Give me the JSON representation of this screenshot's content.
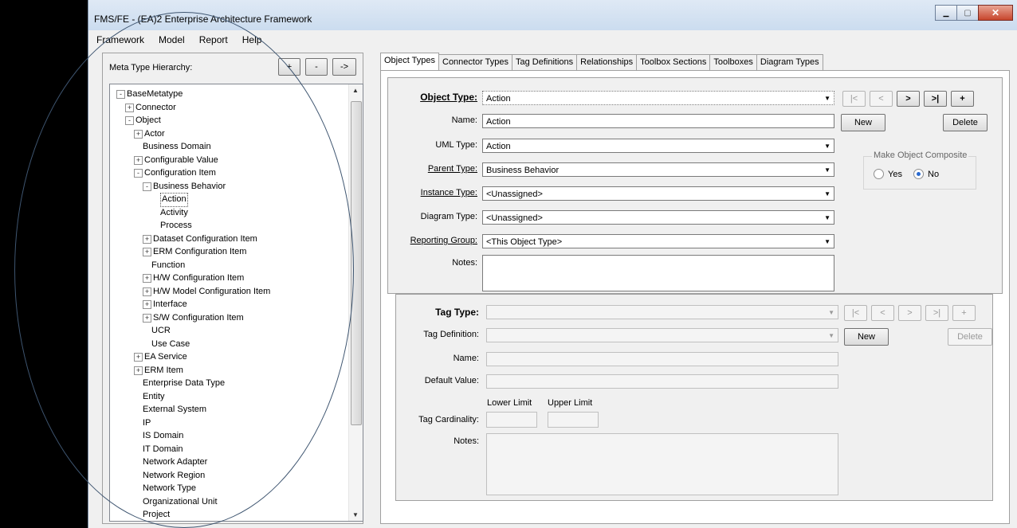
{
  "window": {
    "title": "FMS/FE - (EA)2 Enterprise Architecture Framework",
    "minimize": "▁",
    "maximize": "▢",
    "close": "✕"
  },
  "menu": [
    "Framework",
    "Model",
    "Report",
    "Help"
  ],
  "hierarchy": {
    "label": "Meta Type Hierarchy:",
    "buttons": {
      "add": "+",
      "remove": "-",
      "go": "->"
    },
    "nodes": [
      {
        "label": "BaseMetatype",
        "level": 0,
        "exp": "-"
      },
      {
        "label": "Connector",
        "level": 1,
        "exp": "+"
      },
      {
        "label": "Object",
        "level": 1,
        "exp": "-"
      },
      {
        "label": "Actor",
        "level": 2,
        "exp": "+"
      },
      {
        "label": "Business Domain",
        "level": 2,
        "exp": ""
      },
      {
        "label": "Configurable Value",
        "level": 2,
        "exp": "+"
      },
      {
        "label": "Configuration Item",
        "level": 2,
        "exp": "-"
      },
      {
        "label": "Business Behavior",
        "level": 3,
        "exp": "-"
      },
      {
        "label": "Action",
        "level": 4,
        "exp": "",
        "selected": true
      },
      {
        "label": "Activity",
        "level": 4,
        "exp": ""
      },
      {
        "label": "Process",
        "level": 4,
        "exp": ""
      },
      {
        "label": "Dataset Configuration Item",
        "level": 3,
        "exp": "+"
      },
      {
        "label": "ERM Configuration Item",
        "level": 3,
        "exp": "+"
      },
      {
        "label": "Function",
        "level": 3,
        "exp": ""
      },
      {
        "label": "H/W Configuration Item",
        "level": 3,
        "exp": "+"
      },
      {
        "label": "H/W Model Configuration Item",
        "level": 3,
        "exp": "+"
      },
      {
        "label": "Interface",
        "level": 3,
        "exp": "+"
      },
      {
        "label": "S/W Configuration Item",
        "level": 3,
        "exp": "+"
      },
      {
        "label": "UCR",
        "level": 3,
        "exp": ""
      },
      {
        "label": "Use Case",
        "level": 3,
        "exp": ""
      },
      {
        "label": "EA Service",
        "level": 2,
        "exp": "+"
      },
      {
        "label": "ERM Item",
        "level": 2,
        "exp": "+"
      },
      {
        "label": "Enterprise Data Type",
        "level": 2,
        "exp": ""
      },
      {
        "label": "Entity",
        "level": 2,
        "exp": ""
      },
      {
        "label": "External System",
        "level": 2,
        "exp": ""
      },
      {
        "label": "IP",
        "level": 2,
        "exp": ""
      },
      {
        "label": "IS Domain",
        "level": 2,
        "exp": ""
      },
      {
        "label": "IT Domain",
        "level": 2,
        "exp": ""
      },
      {
        "label": "Network Adapter",
        "level": 2,
        "exp": ""
      },
      {
        "label": "Network Region",
        "level": 2,
        "exp": ""
      },
      {
        "label": "Network Type",
        "level": 2,
        "exp": ""
      },
      {
        "label": "Organizational Unit",
        "level": 2,
        "exp": ""
      },
      {
        "label": "Project",
        "level": 2,
        "exp": ""
      }
    ]
  },
  "tabs": [
    "Object Types",
    "Connector Types",
    "Tag Definitions",
    "Relationships",
    "Toolbox Sections",
    "Toolboxes",
    "Diagram Types"
  ],
  "object": {
    "type_label": "Object Type:",
    "type_value": "Action",
    "name_label": "Name:",
    "name_value": "Action",
    "uml_label": "UML Type:",
    "uml_value": "Action",
    "parent_label": "Parent Type:",
    "parent_value": "Business Behavior",
    "instance_label": "Instance Type:",
    "instance_value": "<Unassigned>",
    "diagram_label": "Diagram Type:",
    "diagram_value": "<Unassigned>",
    "reporting_label": "Reporting Group:",
    "reporting_value": "<This Object Type>",
    "notes_label": "Notes:",
    "nav": [
      "|<",
      "<",
      ">",
      ">|",
      "+"
    ],
    "new": "New",
    "delete": "Delete",
    "composite_legend": "Make Object Composite",
    "yes": "Yes",
    "no": "No",
    "composite_value": "No"
  },
  "tag": {
    "type_label": "Tag Type:",
    "definition_label": "Tag Definition:",
    "name_label": "Name:",
    "default_label": "Default Value:",
    "lower_limit": "Lower Limit",
    "upper_limit": "Upper Limit",
    "cardinality_label": "Tag Cardinality:",
    "notes_label": "Notes:",
    "nav": [
      "|<",
      "<",
      ">",
      ">|",
      "+"
    ],
    "new": "New",
    "delete": "Delete"
  }
}
